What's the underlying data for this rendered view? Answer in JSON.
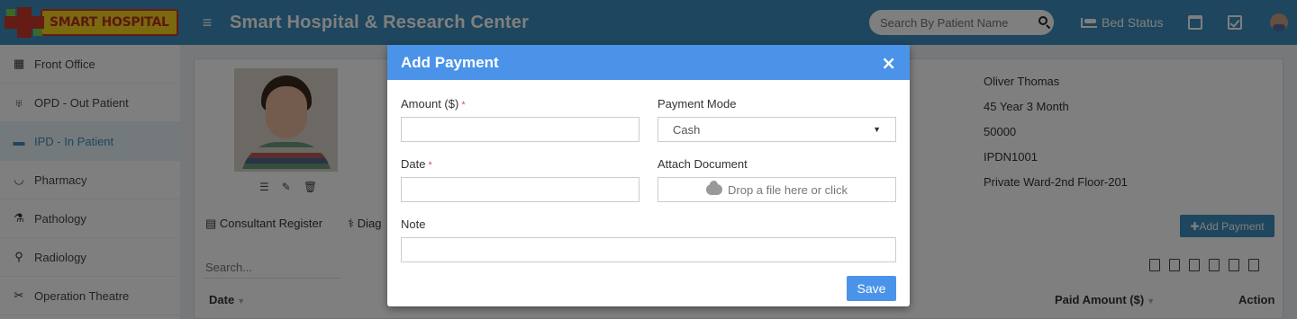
{
  "header": {
    "logo_text": "SMART HOSPITAL",
    "title": "Smart Hospital & Research Center",
    "search_placeholder": "Search By Patient Name",
    "bed_status": "Bed Status"
  },
  "sidebar": {
    "items": [
      {
        "label": "Front Office",
        "icon": "building-icon"
      },
      {
        "label": "OPD - Out Patient",
        "icon": "stethoscope-icon"
      },
      {
        "label": "IPD - In Patient",
        "icon": "bed-icon",
        "active": true
      },
      {
        "label": "Pharmacy",
        "icon": "mortar-icon"
      },
      {
        "label": "Pathology",
        "icon": "flask-icon"
      },
      {
        "label": "Radiology",
        "icon": "microscope-icon"
      },
      {
        "label": "Operation Theatre",
        "icon": "scissors-icon"
      }
    ]
  },
  "patient": {
    "name": "Oliver Thomas",
    "age": "45 Year 3 Month",
    "value3": "50000",
    "ipd_no": "IPDN1001",
    "bed": "Private Ward-2nd Floor-201"
  },
  "tabs": [
    "Consultant Register",
    "Diag"
  ],
  "content": {
    "add_payment": "Add Payment",
    "search_placeholder": "Search...",
    "columns": {
      "date": "Date",
      "paid_amount": "Paid Amount ($)",
      "action": "Action"
    }
  },
  "modal": {
    "title": "Add Payment",
    "close": "×",
    "amount_label": "Amount ($)",
    "payment_mode_label": "Payment Mode",
    "payment_mode_value": "Cash",
    "date_label": "Date",
    "attach_label": "Attach Document",
    "dropzone_text": "Drop a file here or click",
    "note_label": "Note",
    "required_mark": "*",
    "save": "Save"
  },
  "colors": {
    "header": "#3c8dbc",
    "modal_header": "#4a93e8",
    "active_text": "#3c8dbc"
  }
}
